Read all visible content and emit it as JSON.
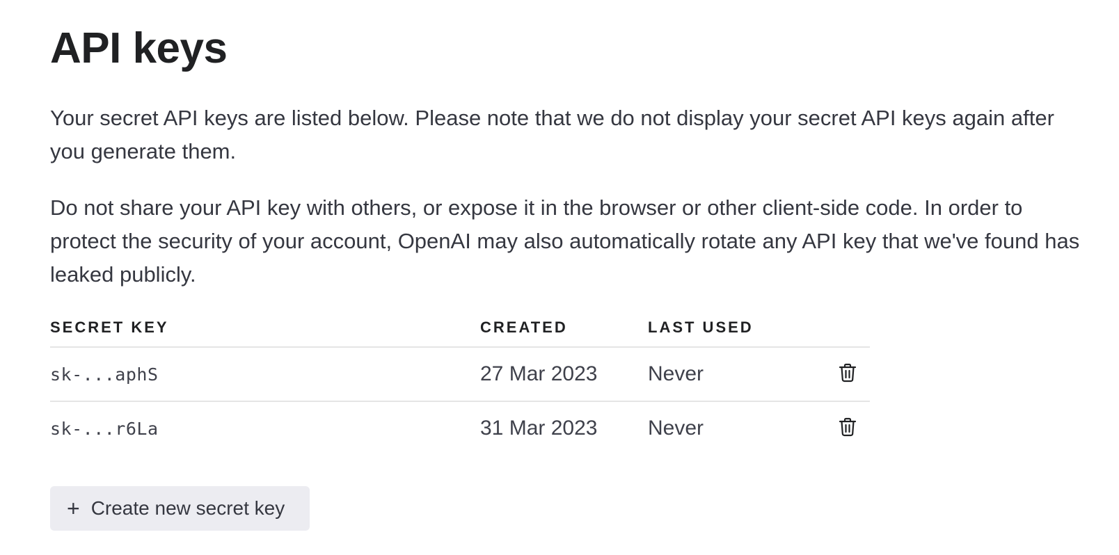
{
  "page": {
    "title": "API keys",
    "description_1": "Your secret API keys are listed below. Please note that we do not display your secret API keys again after you generate them.",
    "description_2": "Do not share your API key with others, or expose it in the browser or other client-side code. In order to protect the security of your account, OpenAI may also automatically rotate any API key that we've found has leaked publicly."
  },
  "table": {
    "headers": {
      "secret_key": "SECRET KEY",
      "created": "CREATED",
      "last_used": "LAST USED"
    },
    "rows": [
      {
        "key": "sk-...aphS",
        "created": "27 Mar 2023",
        "last_used": "Never",
        "action_icon": "trash-icon"
      },
      {
        "key": "sk-...r6La",
        "created": "31 Mar 2023",
        "last_used": "Never",
        "action_icon": "trash-icon"
      }
    ]
  },
  "actions": {
    "create_icon": "plus-icon",
    "create_label": "Create new secret key"
  }
}
